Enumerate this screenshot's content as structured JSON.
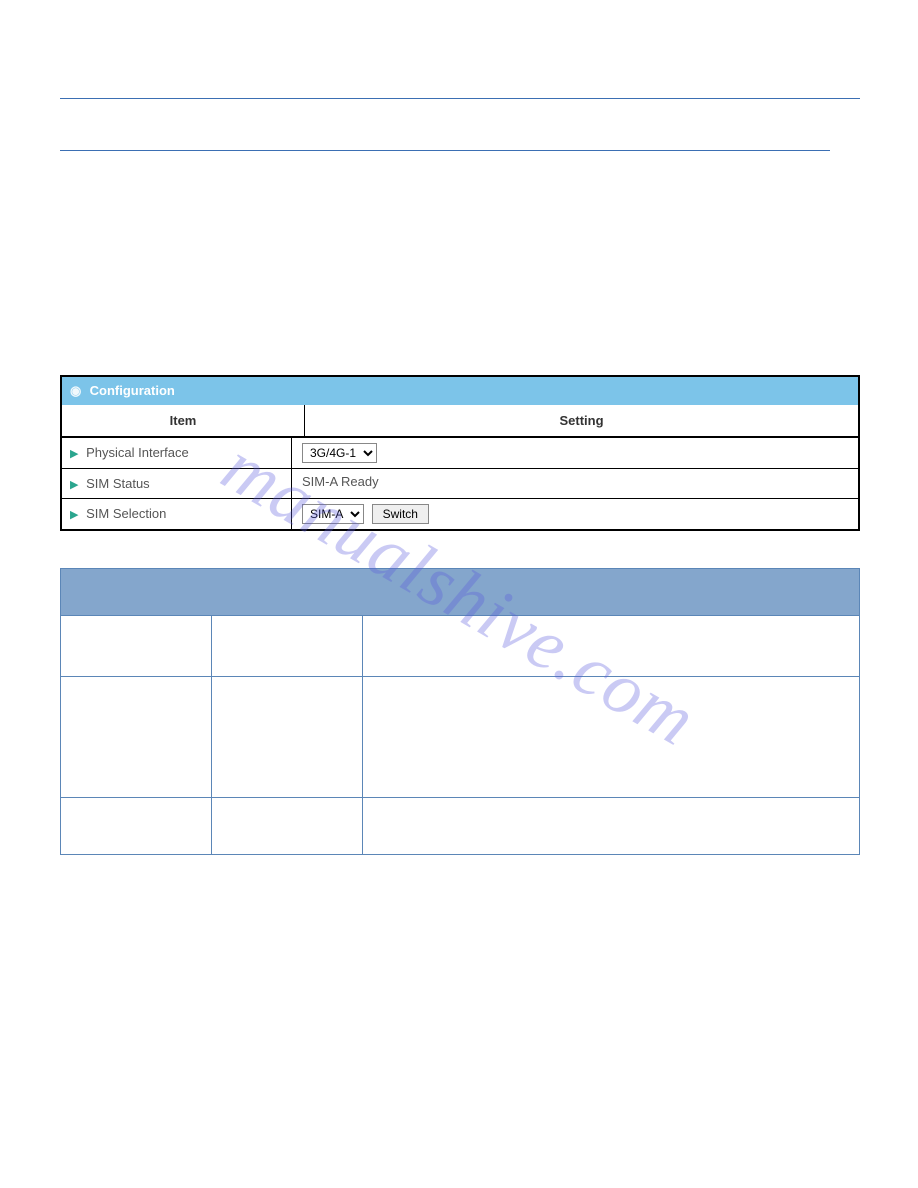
{
  "watermark": "manualshive.com",
  "config": {
    "title": "Configuration",
    "columns": {
      "item": "Item",
      "setting": "Setting"
    },
    "rows": {
      "phys": {
        "label": "Physical Interface",
        "select": "3G/4G-1"
      },
      "simstat": {
        "label": "SIM Status",
        "value": "SIM-A  Ready"
      },
      "simsel": {
        "label": "SIM Selection",
        "select": "SIM-A",
        "button": "Switch"
      }
    }
  }
}
